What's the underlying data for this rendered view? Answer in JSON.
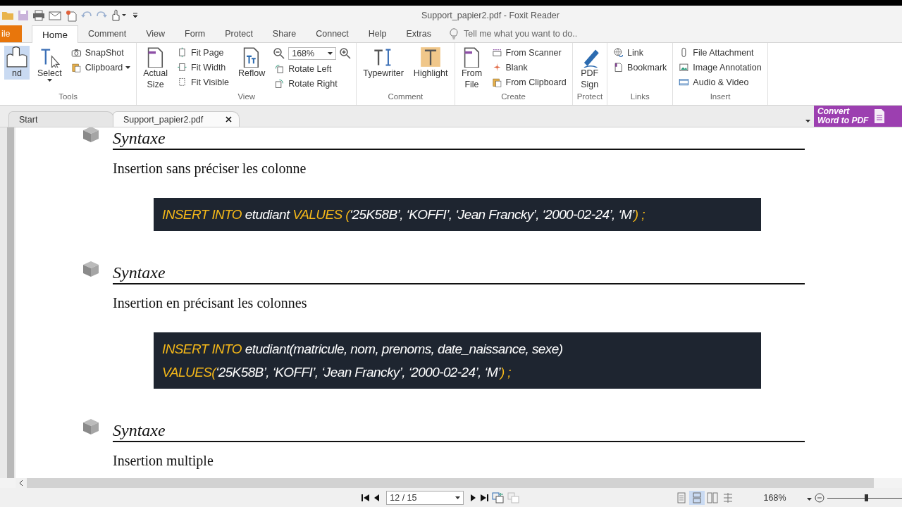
{
  "window": {
    "title": "Support_papier2.pdf - Foxit Reader"
  },
  "menu_tabs": [
    {
      "label": "ile",
      "kind": "file",
      "selected": false
    },
    {
      "label": "Home",
      "kind": "tab",
      "selected": true
    },
    {
      "label": "Comment",
      "kind": "tab",
      "selected": false
    },
    {
      "label": "View",
      "kind": "tab",
      "selected": false
    },
    {
      "label": "Form",
      "kind": "tab",
      "selected": false
    },
    {
      "label": "Protect",
      "kind": "tab",
      "selected": false
    },
    {
      "label": "Share",
      "kind": "tab",
      "selected": false
    },
    {
      "label": "Connect",
      "kind": "tab",
      "selected": false
    },
    {
      "label": "Help",
      "kind": "tab",
      "selected": false
    },
    {
      "label": "Extras",
      "kind": "tab",
      "selected": false
    }
  ],
  "tell_me": {
    "placeholder": "Tell me what you want to do.."
  },
  "ribbon": [
    {
      "label": "Tools",
      "columns": [
        {
          "kind": "large",
          "label": "nd",
          "selected": true
        },
        {
          "kind": "large",
          "label": "Select",
          "selected": false,
          "dropdown": true
        },
        {
          "kind": "stack",
          "items": [
            {
              "label": "SnapShot"
            },
            {
              "label": "Clipboard",
              "dropdown": true
            }
          ]
        }
      ]
    },
    {
      "label": "View",
      "columns": [
        {
          "kind": "large",
          "label": "Actual Size"
        },
        {
          "kind": "stack",
          "items": [
            {
              "label": "Fit Page"
            },
            {
              "label": "Fit Width"
            },
            {
              "label": "Fit Visible"
            }
          ]
        },
        {
          "kind": "large",
          "label": "Reflow"
        },
        {
          "kind": "zoom",
          "value": "168%",
          "items": [
            {
              "label": "Rotate Left"
            },
            {
              "label": "Rotate Right"
            }
          ]
        }
      ]
    },
    {
      "label": "Comment",
      "columns": [
        {
          "kind": "large",
          "label": "Typewriter"
        },
        {
          "kind": "large",
          "label": "Highlight"
        }
      ]
    },
    {
      "label": "Create",
      "columns": [
        {
          "kind": "large",
          "label": "From File"
        },
        {
          "kind": "stack",
          "items": [
            {
              "label": "From Scanner"
            },
            {
              "label": "Blank"
            },
            {
              "label": "From Clipboard"
            }
          ]
        }
      ]
    },
    {
      "label": "Protect",
      "columns": [
        {
          "kind": "large",
          "label": "PDF Sign"
        }
      ]
    },
    {
      "label": "Links",
      "columns": [
        {
          "kind": "stack",
          "items": [
            {
              "label": "Link"
            },
            {
              "label": "Bookmark"
            }
          ]
        }
      ]
    },
    {
      "label": "Insert",
      "columns": [
        {
          "kind": "stack",
          "items": [
            {
              "label": "File Attachment"
            },
            {
              "label": "Image Annotation"
            },
            {
              "label": "Audio & Video"
            }
          ]
        }
      ]
    }
  ],
  "doc_tabs": [
    {
      "label": "Start",
      "selected": false,
      "closable": false
    },
    {
      "label": "Support_papier2.pdf",
      "selected": true,
      "closable": true
    }
  ],
  "convert_banner": {
    "line_1": "Convert",
    "line_2": "Word to PDF"
  },
  "document": {
    "sections": [
      {
        "heading": "Syntaxe",
        "text": "Insertion sans préciser les colonne",
        "code": [
          [
            {
              "kind": "keyword",
              "text": "INSERT INTO"
            },
            {
              "kind": "plain",
              "text": " etudiant "
            },
            {
              "kind": "keyword",
              "text": "VALUES ("
            },
            {
              "kind": "plain",
              "text": "‘25K58B’, ‘KOFFI’, ‘Jean Francky’, ‘2000-02-24’, ‘M’"
            },
            {
              "kind": "keyword",
              "text": ") ;"
            }
          ]
        ]
      },
      {
        "heading": "Syntaxe",
        "text": "Insertion en précisant les colonnes",
        "code": [
          [
            {
              "kind": "keyword",
              "text": "INSERT INTO"
            },
            {
              "kind": "plain",
              "text": " etudiant(matricule, nom, prenoms, date_naissance, sexe)"
            }
          ],
          [
            {
              "kind": "keyword",
              "text": "VALUES("
            },
            {
              "kind": "plain",
              "text": "‘25K58B’, ‘KOFFI’, ‘Jean Francky’, ‘2000-02-24’, ‘M’"
            },
            {
              "kind": "keyword",
              "text": ") ;"
            }
          ]
        ]
      },
      {
        "heading": "Syntaxe",
        "text": "Insertion multiple"
      }
    ]
  },
  "status_bar": {
    "page": "12 / 15",
    "view_modes": [
      {
        "selected": false
      },
      {
        "selected": true
      },
      {
        "selected": false
      },
      {
        "selected": false
      }
    ],
    "zoom": "168%",
    "zoom_slider": {
      "level": 0.5
    }
  }
}
